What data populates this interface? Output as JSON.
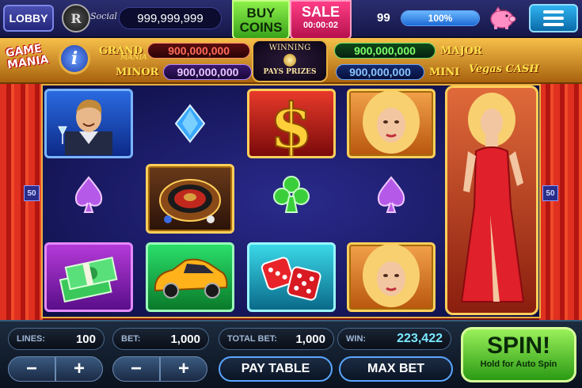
{
  "topbar": {
    "lobby_label": "LOBBY",
    "avatar_letter": "R",
    "social_label": "Social",
    "balance": "999,999,999",
    "buy_coins_label": "BUY COINS",
    "sale_label": "SALE",
    "sale_timer": "00:00:02",
    "level": "99",
    "xp_percent": 100,
    "xp_label": "100%"
  },
  "header": {
    "game_title": "GAME MANIA",
    "info_label": "i",
    "jackpots": {
      "grand": {
        "label": "GRAND",
        "sublabel": "MANIA",
        "value": "900,000,000"
      },
      "minor": {
        "label": "MINOR",
        "value": "900,000,000"
      },
      "major": {
        "label": "MAJOR",
        "value": "900,000,000"
      },
      "mini": {
        "label": "MINI",
        "value": "900,000,000"
      }
    },
    "winning_badge": {
      "line1": "WINNING",
      "line2": "PAYS PRIZES"
    },
    "brand": "Vegas CASH"
  },
  "reels": {
    "left_line": "50",
    "right_line": "50",
    "symbols": [
      [
        "man-with-martini",
        "diamond",
        "gold-dollar",
        "blonde-woman",
        "woman-in-red-dress"
      ],
      [
        "",
        "spade",
        "roulette-wheel",
        "club",
        "spade"
      ],
      [
        "cash-stack",
        "sports-car",
        "dice",
        "blonde-woman",
        ""
      ]
    ]
  },
  "controls": {
    "lines_label": "LINES:",
    "lines_value": "100",
    "bet_label": "BET:",
    "bet_value": "1,000",
    "total_bet_label": "TOTAL BET:",
    "total_bet_value": "1,000",
    "win_label": "WIN:",
    "win_value": "223,422",
    "minus": "−",
    "plus": "+",
    "pay_table_label": "PAY TABLE",
    "max_bet_label": "MAX BET",
    "spin_label": "SPIN!",
    "spin_sublabel": "Hold for Auto Spin"
  },
  "colors": {
    "spin_green": "#2a9a14",
    "gold_frame": "#e8b040",
    "sale_pink": "#ff3d86"
  }
}
